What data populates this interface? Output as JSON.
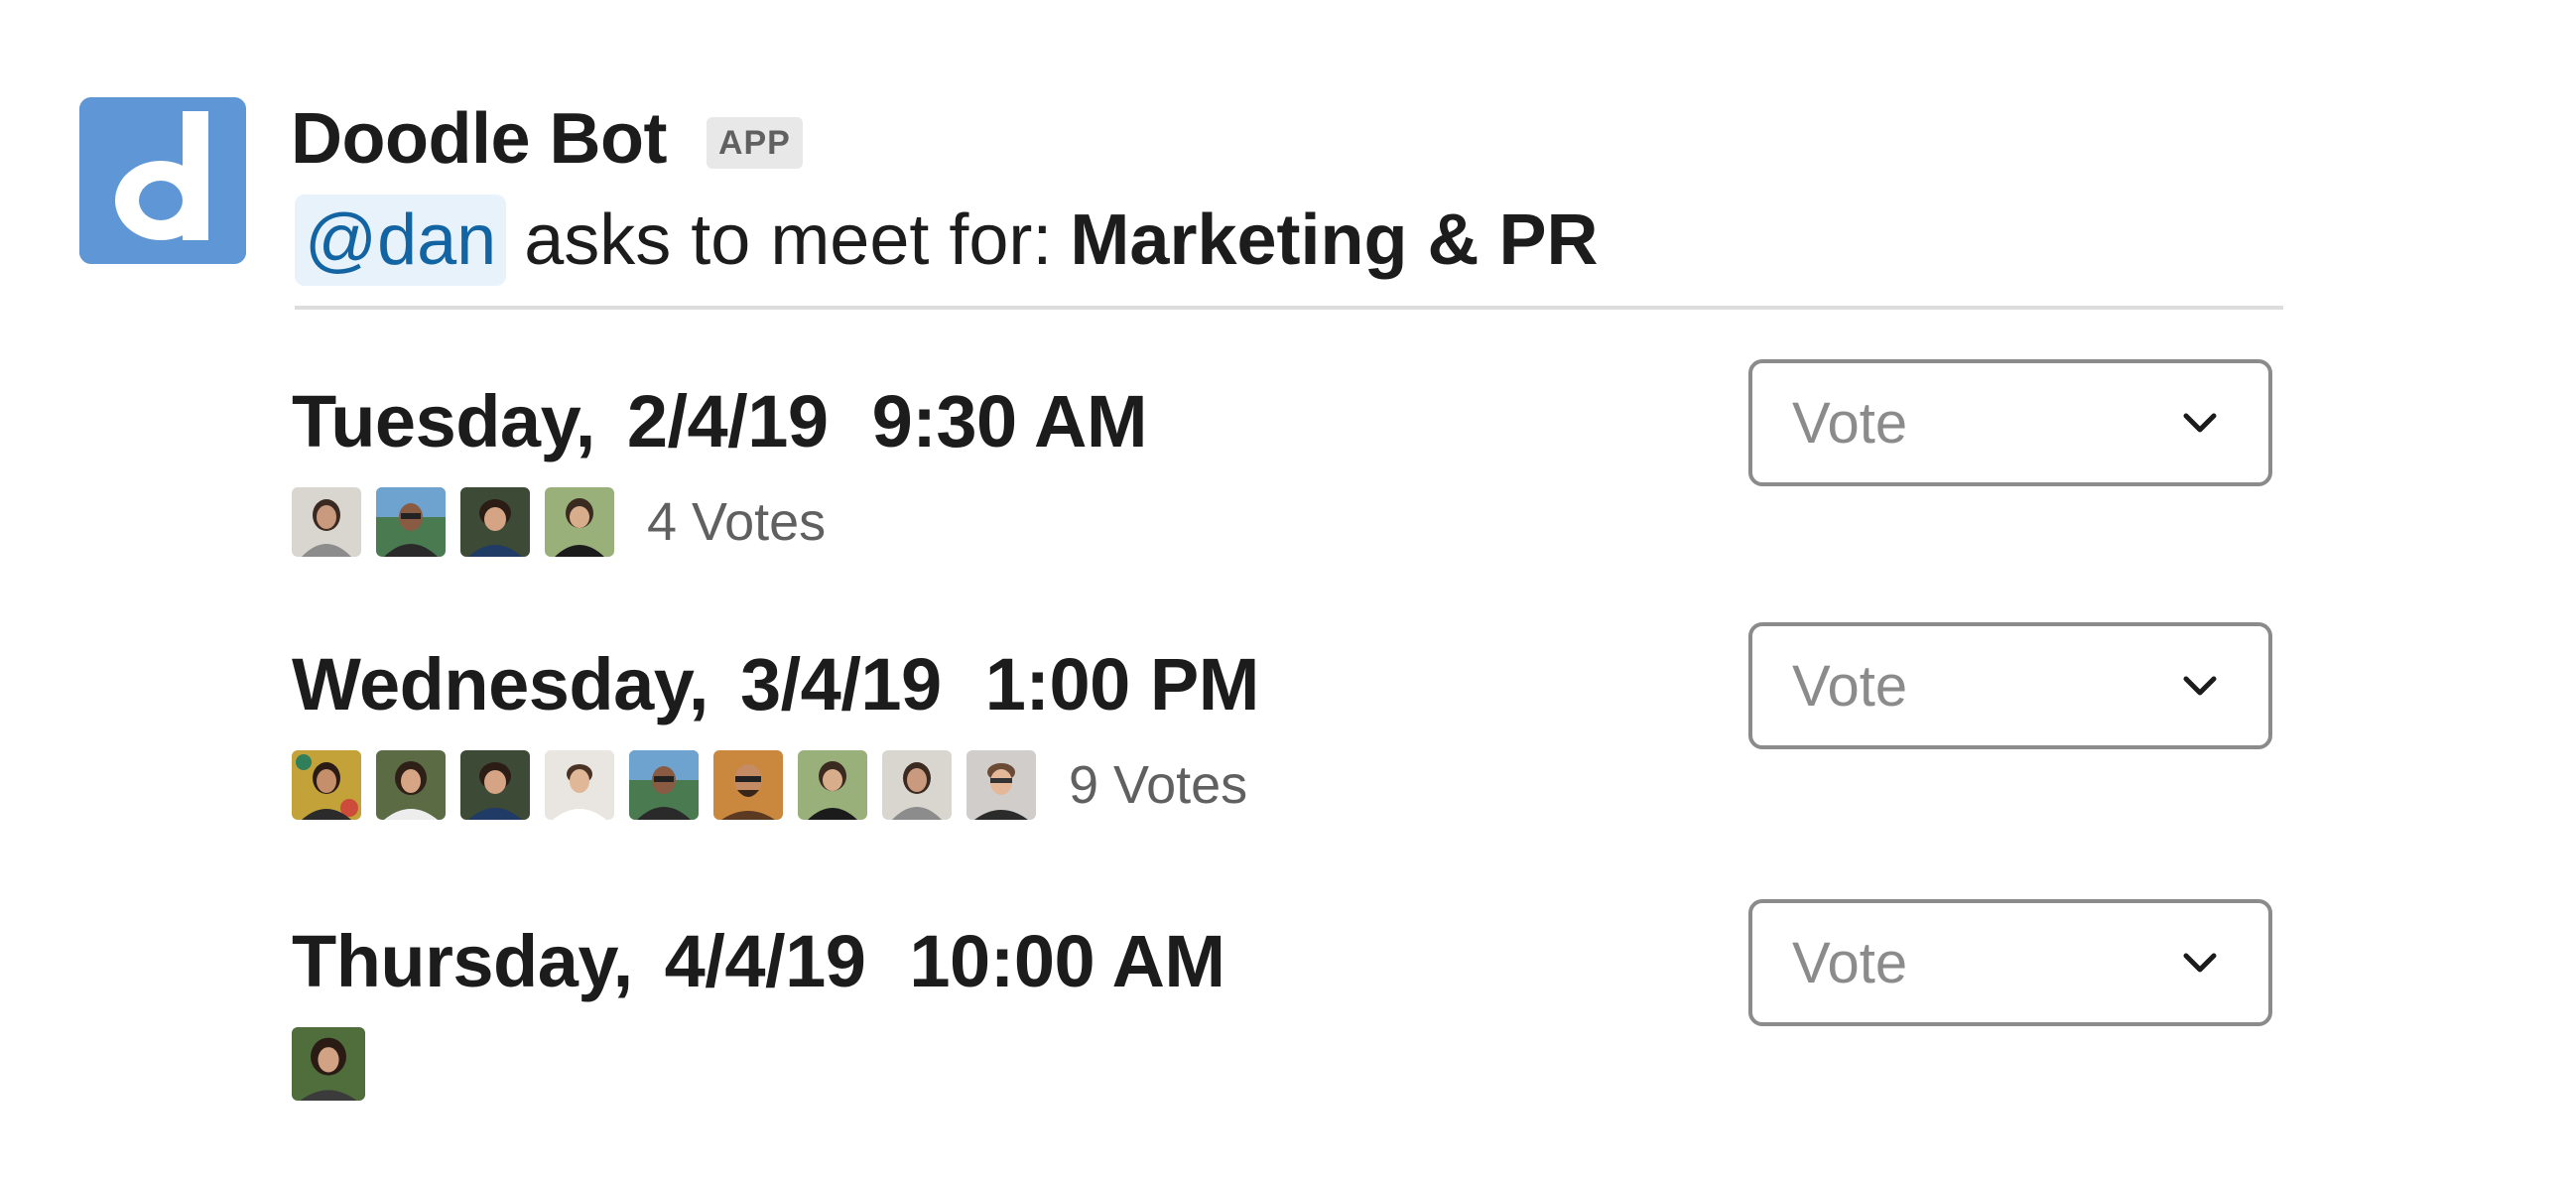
{
  "message": {
    "bot_name": "Doodle Bot",
    "badge": "APP",
    "mention": "@dan",
    "asks_text": "asks to meet for:",
    "topic": "Marketing & PR"
  },
  "options": [
    {
      "day": "Tuesday,",
      "date": "2/4/19",
      "time": "9:30 AM",
      "vote_count": "4 Votes",
      "select_placeholder": "Vote"
    },
    {
      "day": "Wednesday,",
      "date": "3/4/19",
      "time": "1:00 PM",
      "vote_count": "9 Votes",
      "select_placeholder": "Vote"
    },
    {
      "day": "Thursday,",
      "date": "4/4/19",
      "time": "10:00 AM",
      "vote_count": "",
      "select_placeholder": "Vote"
    }
  ],
  "icons": {
    "app_logo": "doodle-d-logo",
    "dropdown": "chevron-down-icon"
  },
  "colors": {
    "logo_bg": "#5f97d6",
    "mention_text": "#1264a3",
    "mention_bg": "#e8f2fb",
    "muted_text": "#616061",
    "select_border": "#8b8b8b"
  }
}
